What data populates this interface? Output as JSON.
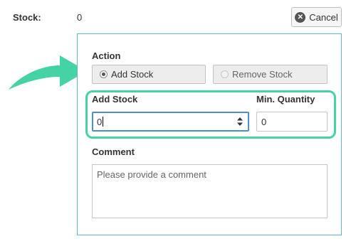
{
  "stock": {
    "label": "Stock:",
    "value": "0"
  },
  "cancel_button": {
    "label": "Cancel",
    "icon": "close-icon"
  },
  "action": {
    "label": "Action",
    "options": [
      {
        "label": "Add Stock",
        "selected": true
      },
      {
        "label": "Remove Stock",
        "selected": false
      }
    ]
  },
  "add_stock": {
    "label": "Add Stock",
    "value": "0"
  },
  "min_quantity": {
    "label": "Min. Quantity",
    "value": "0"
  },
  "comment": {
    "label": "Comment",
    "placeholder": "Please provide a comment"
  },
  "colors": {
    "highlight": "#45d2a4",
    "panel_border": "#5cbac7",
    "focus": "#4d90c9"
  }
}
